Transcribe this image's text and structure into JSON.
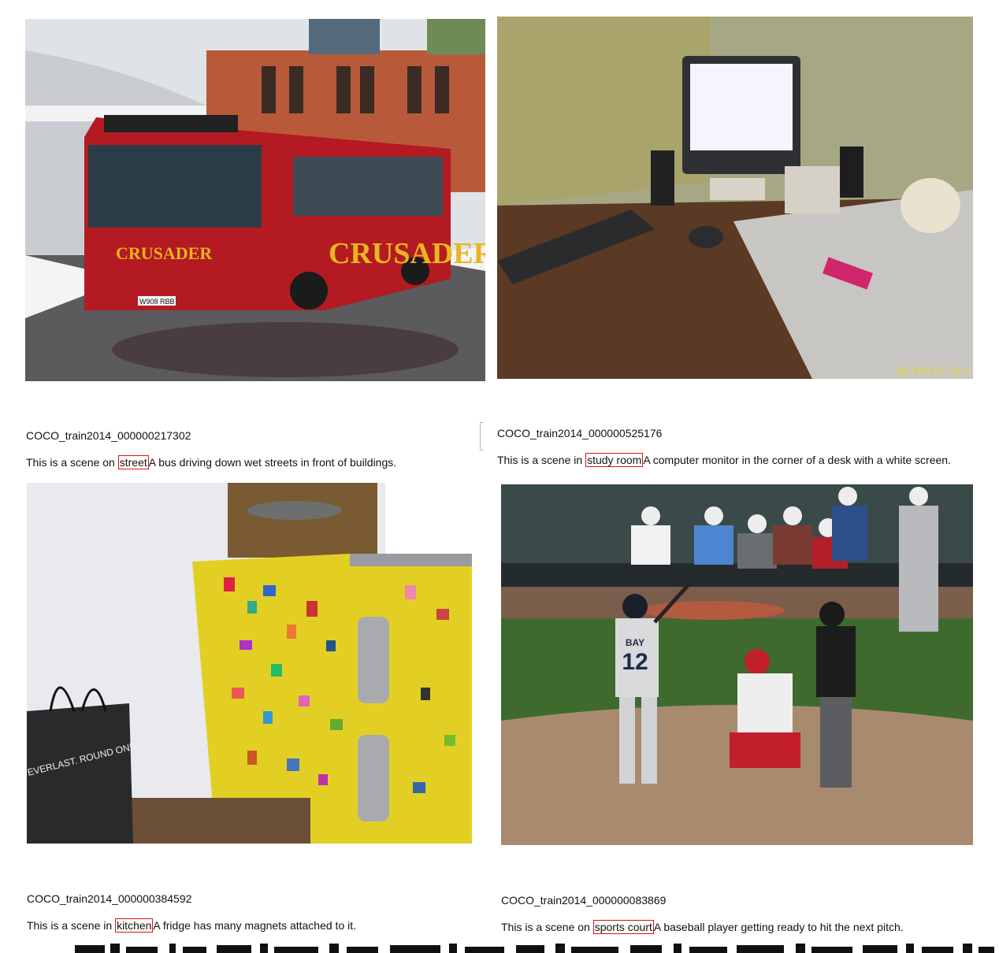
{
  "panels": [
    {
      "id": "COCO_train2014_000000217302",
      "prefix": "This is a scene on",
      "scene": "street",
      "caption": "A bus driving down wet streets in front of buildings.",
      "bus_destination": "CRUSADER",
      "bus_plate": "W908 RBB"
    },
    {
      "id": "COCO_train2014_000000525176",
      "prefix": "This is a scene in",
      "scene": "study room",
      "caption": "A computer monitor in the corner of a desk with a white screen.",
      "timestamp": "28-Feb-07 22:1"
    },
    {
      "id": "COCO_train2014_000000384592",
      "prefix": "This is a scene in",
      "scene": "kitchen",
      "caption": "A fridge has many magnets attached to it.",
      "bag_text": "EVERLAST. ROUND ONE."
    },
    {
      "id": "COCO_train2014_000000083869",
      "prefix": "This is a scene on",
      "scene": "sports court",
      "caption": "A baseball player getting ready to hit the next pitch.",
      "jersey_name": "BAY",
      "jersey_number": "12"
    }
  ],
  "colors": {
    "tag_border": "#dd1111"
  }
}
